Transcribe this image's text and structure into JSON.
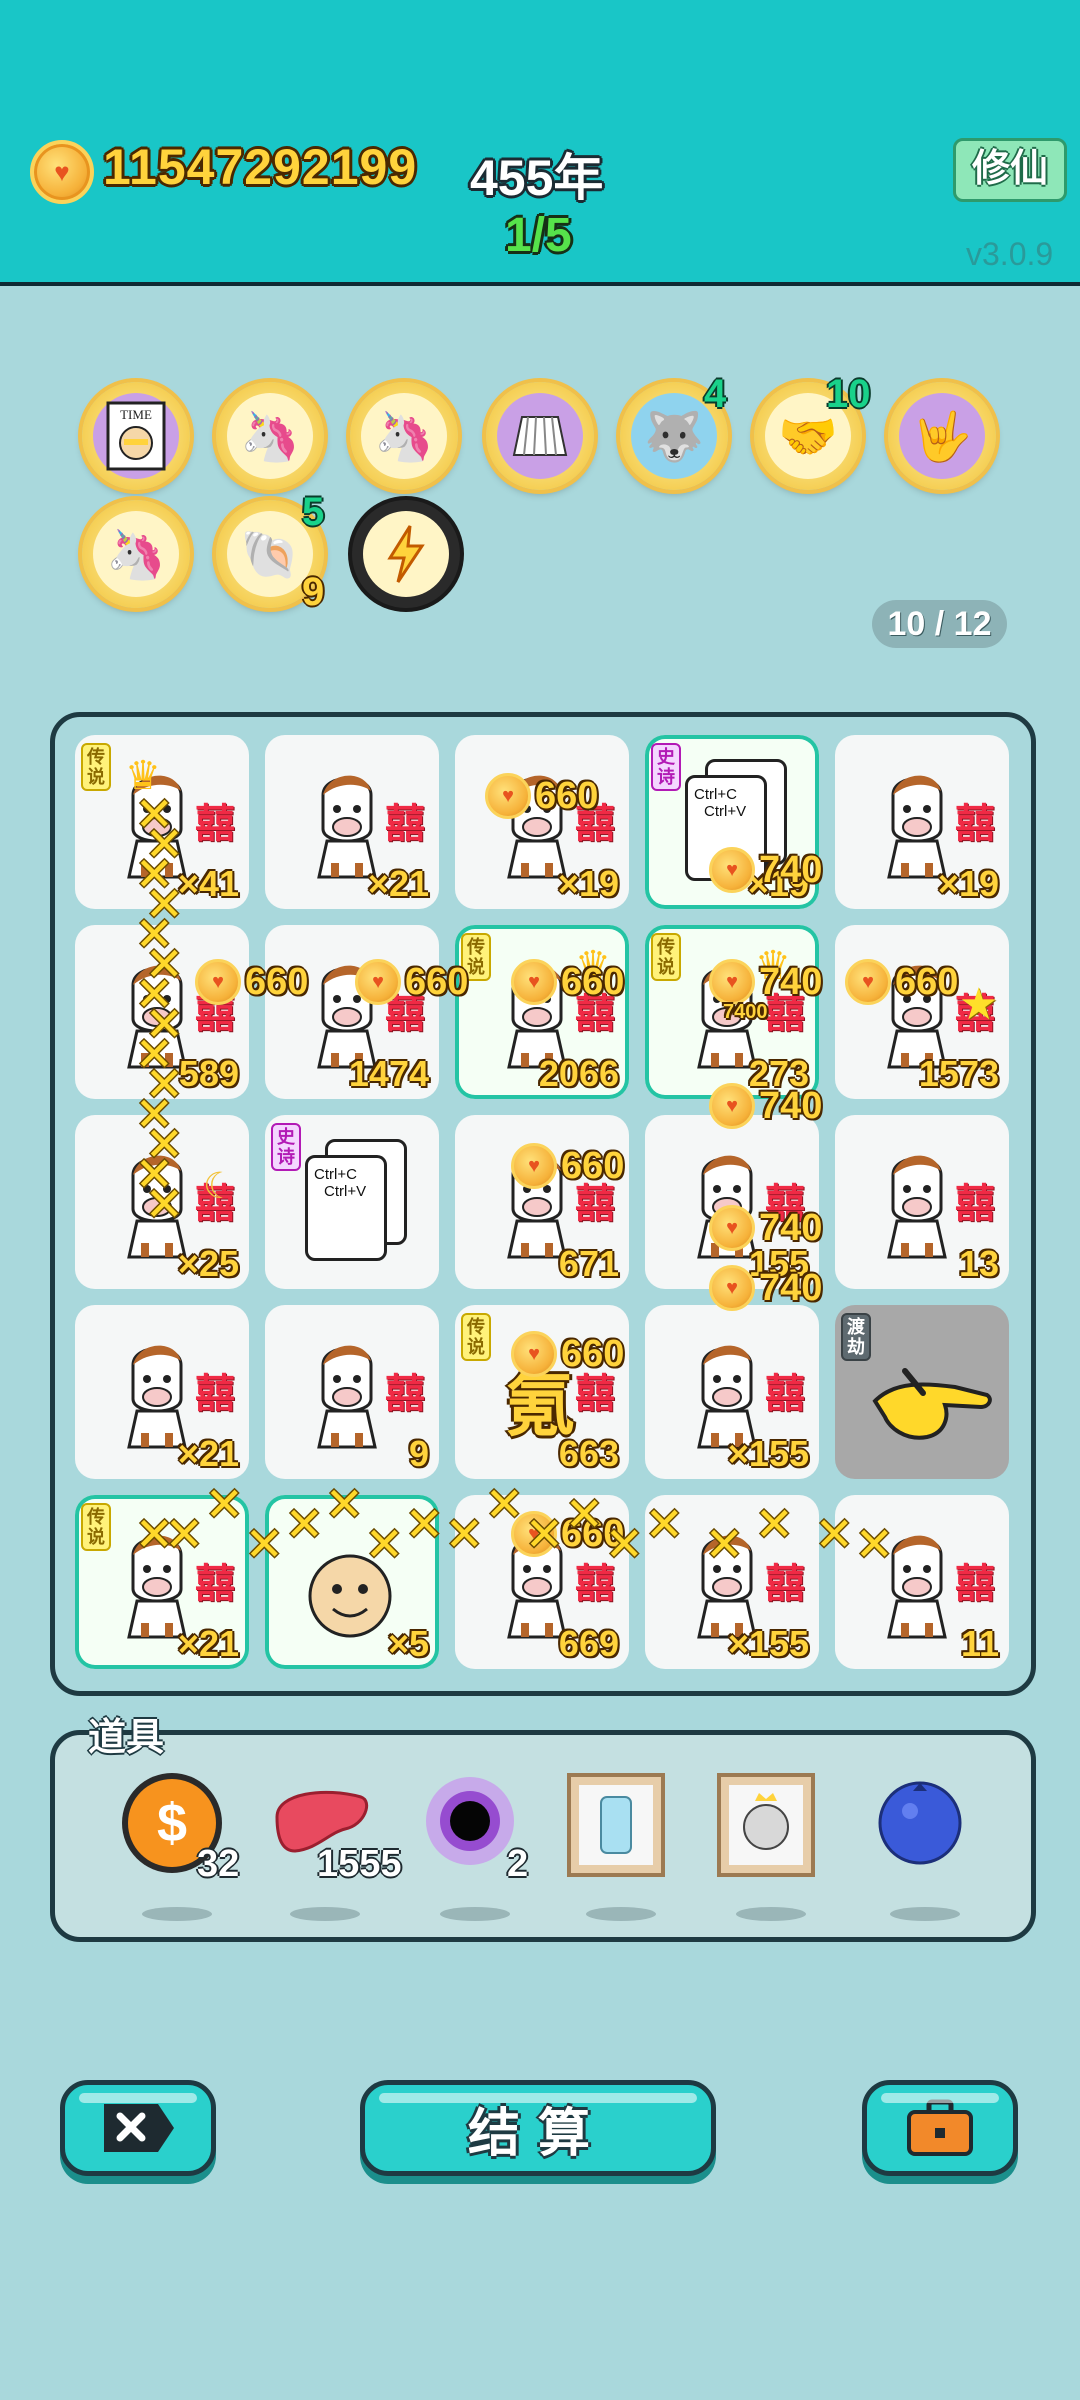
{
  "header": {
    "coins": "11547292199",
    "year": "455年",
    "progress": "1/5",
    "xiuxian_label": "修仙",
    "version": "v3.0.9"
  },
  "relics": [
    {
      "icon": "time-magazine-icon",
      "badge": ""
    },
    {
      "icon": "unicorn-icon",
      "badge": ""
    },
    {
      "icon": "unicorn-icon",
      "badge": ""
    },
    {
      "icon": "skirt-icon",
      "badge": ""
    },
    {
      "icon": "husky-dog-icon",
      "badge": "4"
    },
    {
      "icon": "handshake-icon",
      "badge": "10"
    },
    {
      "icon": "rock-hand-icon",
      "badge": ""
    },
    {
      "icon": "unicorn-icon",
      "badge": ""
    },
    {
      "icon": "seashell-icon",
      "badge": "5",
      "badge2": "9"
    },
    {
      "icon": "lightning-icon",
      "badge": ""
    }
  ],
  "page_indicator": "10 / 12",
  "grid": {
    "cells": [
      {
        "tag": "传说",
        "count": "×41",
        "item": "horse"
      },
      {
        "tag": "",
        "count": "×21",
        "item": "horse"
      },
      {
        "tag": "",
        "count": "×19",
        "item": "horse"
      },
      {
        "tag": "史诗",
        "count": "×19",
        "item": "ctrl-cv"
      },
      {
        "tag": "",
        "count": "×19",
        "item": "horse"
      },
      {
        "tag": "",
        "count": "589",
        "item": "horse"
      },
      {
        "tag": "",
        "count": "1474",
        "item": "horse"
      },
      {
        "tag": "传说",
        "count": "2066",
        "item": "horse"
      },
      {
        "tag": "传说",
        "count": "273",
        "item": "horse"
      },
      {
        "tag": "",
        "count": "1573",
        "item": "horse"
      },
      {
        "tag": "",
        "count": "×25",
        "item": "horse"
      },
      {
        "tag": "史诗",
        "count": "",
        "item": "ctrl-cv"
      },
      {
        "tag": "",
        "count": "671",
        "item": "horse"
      },
      {
        "tag": "",
        "count": "155",
        "item": "horse"
      },
      {
        "tag": "",
        "count": "13",
        "item": "horse"
      },
      {
        "tag": "",
        "count": "×21",
        "item": "horse"
      },
      {
        "tag": "",
        "count": "9",
        "item": "horse"
      },
      {
        "tag": "传说",
        "count": "663",
        "item": "char"
      },
      {
        "tag": "",
        "count": "×155",
        "item": "horse"
      },
      {
        "tag": "渡劫",
        "count": "",
        "item": "pointing-hand"
      },
      {
        "tag": "传说",
        "count": "×21",
        "item": "horse"
      },
      {
        "tag": "",
        "count": "×5",
        "item": "face"
      },
      {
        "tag": "",
        "count": "669",
        "item": "horse"
      },
      {
        "tag": "",
        "count": "×155",
        "item": "horse"
      },
      {
        "tag": "",
        "count": "11",
        "item": "horse"
      }
    ],
    "xi_char": "囍",
    "ctrl_text_1": "Ctrl+C",
    "ctrl_text_2": "Ctrl+V",
    "char_glyph": "氪",
    "popups": {
      "v660": "660",
      "v740": "740",
      "v7400": "7400"
    }
  },
  "props": {
    "title": "道具",
    "items": [
      {
        "icon": "dollar-coin-icon",
        "count": "32"
      },
      {
        "icon": "liver-icon",
        "count": "1555"
      },
      {
        "icon": "black-hole-icon",
        "count": "2"
      },
      {
        "icon": "fridge-picture-icon",
        "count": ""
      },
      {
        "icon": "husky-picture-icon",
        "count": ""
      },
      {
        "icon": "blueberry-icon",
        "count": ""
      }
    ]
  },
  "buttons": {
    "close_icon": "close-x-icon",
    "settle_label": "结算",
    "bag_icon": "briefcase-icon"
  },
  "colors": {
    "header_bg": "#19c6c7",
    "page_bg": "#a9d8dc",
    "gold": "#ffd33c",
    "accent_green": "#56e34b",
    "button_teal": "#2ad0cc",
    "xi_red": "#f02a45"
  }
}
